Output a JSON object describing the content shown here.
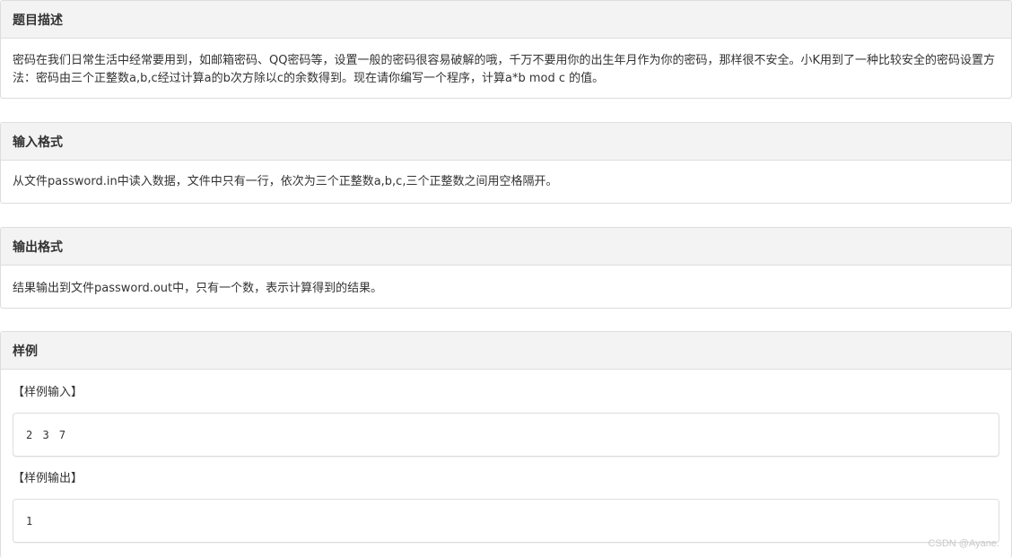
{
  "sections": {
    "description": {
      "title": "题目描述",
      "body": "密码在我们日常生活中经常要用到，如邮箱密码、QQ密码等，设置一般的密码很容易破解的哦，千万不要用你的出生年月作为你的密码，那样很不安全。小K用到了一种比较安全的密码设置方法：密码由三个正整数a,b,c经过计算a的b次方除以c的余数得到。现在请你编写一个程序，计算a*b mod c 的值。"
    },
    "input_format": {
      "title": "输入格式",
      "body": "从文件password.in中读入数据，文件中只有一行，依次为三个正整数a,b,c,三个正整数之间用空格隔开。"
    },
    "output_format": {
      "title": "输出格式",
      "body": "结果输出到文件password.out中，只有一个数，表示计算得到的结果。"
    },
    "sample": {
      "title": "样例",
      "input_label": "【样例输入】",
      "input_value": "2 3 7",
      "output_label": "【样例输出】",
      "output_value": "1"
    }
  },
  "watermark": "CSDN @Ayane."
}
